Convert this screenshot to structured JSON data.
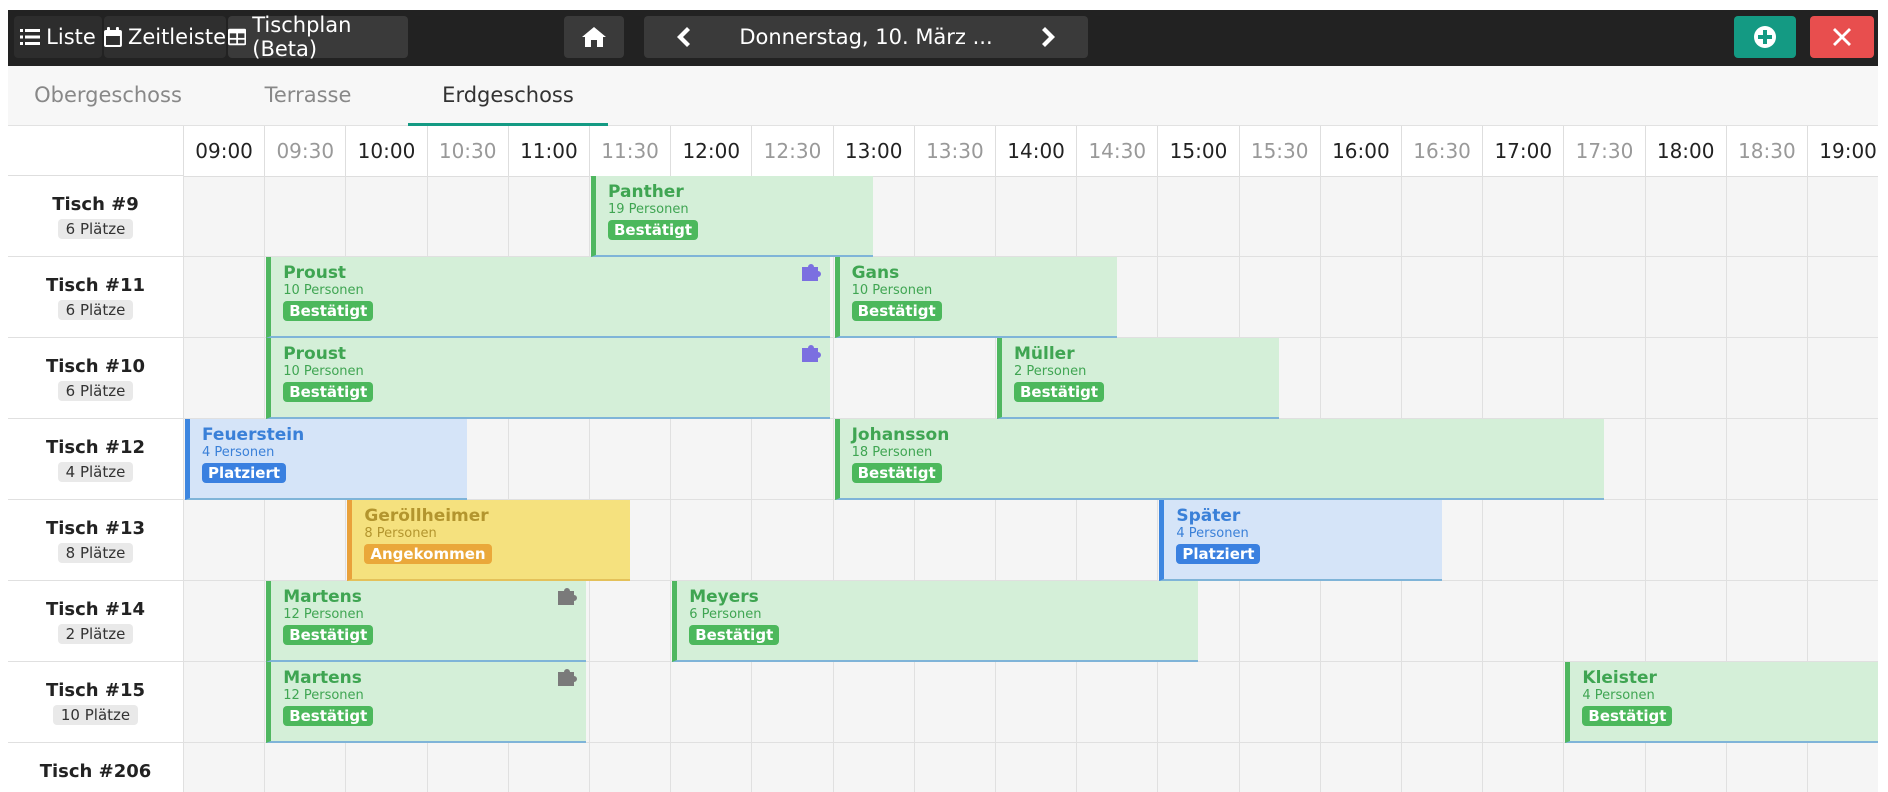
{
  "toolbar": {
    "view_list": "Liste",
    "view_timeline": "Zeitleiste",
    "view_tableplan": "Tischplan (Beta)",
    "date": "Donnerstag, 10. März ...",
    "icons": {
      "list": "list-icon",
      "calendar": "calendar-icon",
      "table": "table-icon",
      "home": "home-icon",
      "prev": "chevron-left-icon",
      "next": "chevron-right-icon",
      "add": "plus-circle-icon",
      "close": "close-icon"
    },
    "colors": {
      "add": "#149a83",
      "close": "#e84e4e"
    }
  },
  "tabs": [
    {
      "label": "Obergeschoss"
    },
    {
      "label": "Terrasse"
    },
    {
      "label": "Erdgeschoss",
      "active": true
    }
  ],
  "times": [
    "09:00",
    "09:30",
    "10:00",
    "10:30",
    "11:00",
    "11:30",
    "12:00",
    "12:30",
    "13:00",
    "13:30",
    "14:00",
    "14:30",
    "15:00",
    "15:30",
    "16:00",
    "16:30",
    "17:00",
    "17:30",
    "18:00",
    "18:30",
    "19:00"
  ],
  "tables": [
    {
      "name": "Tisch #9",
      "seats": "6 Plätze"
    },
    {
      "name": "Tisch #11",
      "seats": "6 Plätze"
    },
    {
      "name": "Tisch #10",
      "seats": "6 Plätze"
    },
    {
      "name": "Tisch #12",
      "seats": "4 Plätze"
    },
    {
      "name": "Tisch #13",
      "seats": "8 Plätze"
    },
    {
      "name": "Tisch #14",
      "seats": "2 Plätze"
    },
    {
      "name": "Tisch #15",
      "seats": "10 Plätze"
    },
    {
      "name": "Tisch #206",
      "seats": ""
    }
  ],
  "bookings": [
    {
      "row": 0,
      "name": "Panther",
      "persons": "19 Personen",
      "status": "Bestätigt",
      "kind": "g",
      "start": "11:30",
      "end": "13:15"
    },
    {
      "row": 1,
      "name": "Proust",
      "persons": "10 Personen",
      "status": "Bestätigt",
      "kind": "g",
      "start": "09:30",
      "end": "12:59",
      "puzzle": true,
      "puzzle_color": "#7b6fe0"
    },
    {
      "row": 1,
      "name": "Gans",
      "persons": "10 Personen",
      "status": "Bestätigt",
      "kind": "g",
      "start": "13:00",
      "end": "14:45"
    },
    {
      "row": 2,
      "name": "Proust",
      "persons": "10 Personen",
      "status": "Bestätigt",
      "kind": "g",
      "start": "09:30",
      "end": "12:59",
      "puzzle": true,
      "puzzle_color": "#7b6fe0"
    },
    {
      "row": 2,
      "name": "Müller",
      "persons": "2 Personen",
      "status": "Bestätigt",
      "kind": "g",
      "start": "14:00",
      "end": "15:45"
    },
    {
      "row": 3,
      "name": "Feuerstein",
      "persons": "4 Personen",
      "status": "Platziert",
      "kind": "b",
      "start": "09:00",
      "end": "10:45"
    },
    {
      "row": 3,
      "name": "Johansson",
      "persons": "18 Personen",
      "status": "Bestätigt",
      "kind": "g",
      "start": "13:00",
      "end": "17:45"
    },
    {
      "row": 4,
      "name": "Geröllheimer",
      "persons": "8 Personen",
      "status": "Angekommen",
      "kind": "y",
      "start": "10:00",
      "end": "11:45"
    },
    {
      "row": 4,
      "name": "Später",
      "persons": "4 Personen",
      "status": "Platziert",
      "kind": "b",
      "start": "15:00",
      "end": "16:45"
    },
    {
      "row": 5,
      "name": "Martens",
      "persons": "12 Personen",
      "status": "Bestätigt",
      "kind": "g",
      "start": "09:30",
      "end": "11:29",
      "puzzle": true,
      "puzzle_color": "#7a7a7a"
    },
    {
      "row": 5,
      "name": "Meyers",
      "persons": "6 Personen",
      "status": "Bestätigt",
      "kind": "g",
      "start": "12:00",
      "end": "15:15"
    },
    {
      "row": 6,
      "name": "Martens",
      "persons": "12 Personen",
      "status": "Bestätigt",
      "kind": "g",
      "start": "09:30",
      "end": "11:29",
      "puzzle": true,
      "puzzle_color": "#7a7a7a"
    },
    {
      "row": 6,
      "name": "Kleister",
      "persons": "4 Personen",
      "status": "Bestätigt",
      "kind": "g",
      "start": "17:30",
      "end": "19:30"
    }
  ]
}
